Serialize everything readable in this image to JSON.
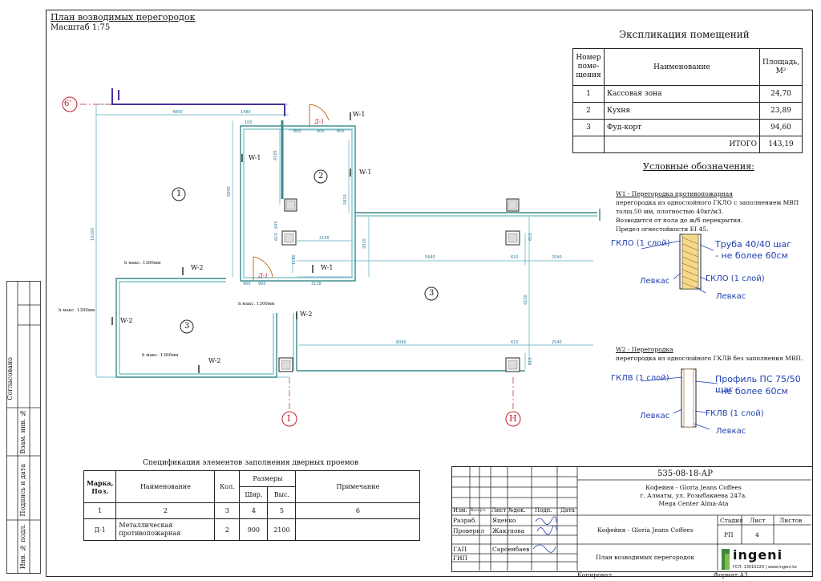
{
  "header": {
    "title": "План возводимых перегородок",
    "scale": "Масштаб 1:75"
  },
  "axes": {
    "a6": "6'",
    "i": "I",
    "n": "Н"
  },
  "rooms": [
    {
      "num": "1"
    },
    {
      "num": "2"
    },
    {
      "num": "3"
    },
    {
      "num": "3"
    }
  ],
  "wall_labels": [
    "W-1",
    "W-1",
    "W-1",
    "W-1",
    "W-2",
    "W-2",
    "W-2",
    "W-2"
  ],
  "door_labels": [
    "Д-1",
    "Д-1"
  ],
  "heights": [
    "h макс. 1300мм",
    "h макс. 1300мм",
    "h макс. 1300мм",
    "h макс. 1300мм"
  ],
  "dims": [
    "4800",
    "1480",
    "100",
    "800",
    "900",
    "800",
    "4105",
    "6000",
    "10200",
    "5810",
    "2145",
    "2020",
    "5845",
    "610",
    "2540",
    "4230",
    "8090",
    "610",
    "2540",
    "610",
    "1180",
    "610",
    "900",
    "3118",
    "960",
    "1075",
    "645",
    "610"
  ],
  "explication": {
    "title": "Экспликация помещений",
    "headers": [
      "Номер поме-щения",
      "Наименование",
      "Площадь, М²"
    ],
    "rows": [
      [
        "1",
        "Кассовая зона",
        "24,70"
      ],
      [
        "2",
        "Кухня",
        "23,89"
      ],
      [
        "3",
        "Фуд-корт",
        "94,60"
      ]
    ],
    "total_label": "ИТОГО",
    "total": "143,19"
  },
  "legend": {
    "title": "Условные обозначения:",
    "w1_title": "W1 - Перегородка противопожарная",
    "w1_lines": [
      "перегородка из однослойного ГКЛО с заполнением МВП",
      "толщ.50 мм, плотностью 40кг/м3.",
      "Возводится от пола до ж/б перекрытия.",
      "Предел огнестойкости EI 45."
    ],
    "w1_labels": {
      "left_top": "ГКЛО (1 слой)",
      "pipe": "Труба 40/40 шаг",
      "pipe2": "- не более 60см",
      "levkas1": "Левкас",
      "right_mid": "ГКЛО (1 слой)",
      "levkas2": "Левкас"
    },
    "w2_title": "W2 - Перегородка",
    "w2_lines": [
      "перегородка из однослойного ГКЛВ без заполнения МВП."
    ],
    "w2_labels": {
      "left_top": "ГКЛВ (1 слой)",
      "profile": "Профиль ПС 75/50 шаг",
      "profile2": "- не более 60см",
      "levkas1": "Левкас",
      "right_mid": "ГКЛВ (1 слой)",
      "levkas2": "Левкас"
    }
  },
  "spec": {
    "title": "Спецификация элементов заполнения дверных проемов",
    "h_mark": "Марка, Поз.",
    "h_name": "Наименование",
    "h_qty": "Кол.",
    "h_sizes": "Размеры",
    "h_w": "Шир.",
    "h_h": "Выс.",
    "h_note": "Примечание",
    "idx": [
      "1",
      "2",
      "3",
      "4",
      "5",
      "6"
    ],
    "row": {
      "mark": "Д-1",
      "name": "Металлическая противопожарная",
      "qty": "2",
      "w": "900",
      "h": "2100",
      "note": ""
    }
  },
  "stamp": {
    "code": "535-08-18-АР",
    "project_lines": [
      "Кофейня - Gloria Jeans Coffees",
      "г. Алматы, ул. Розыбакиева 247а.",
      "Mega Center Alma-Ata"
    ],
    "cols": [
      "Изм.",
      "Кол.уч.",
      "Лист",
      "№док.",
      "Подп.",
      "Дата"
    ],
    "r1": [
      "Разраб.",
      "Яценко"
    ],
    "r2": [
      "Проверил",
      "Жакупова"
    ],
    "r3": [
      "ГАП",
      "Сарсенбаев"
    ],
    "r4": [
      "ГИП",
      ""
    ],
    "object": "Кофейня - Gloria Jeans Coffees",
    "sheet_name": "План возводимых перегородок",
    "stage_h": "Стадия",
    "sheet_h": "Лист",
    "sheets_h": "Листов",
    "stage": "РП",
    "sheet": "4",
    "sheets": "",
    "copied": "Копировал",
    "format": "Формат А3",
    "logo": "ingeni",
    "logo_sub": "ГСЛ: 13010220 | www.ingeni.kz"
  },
  "sidebar": [
    "Согласовано",
    "Взам. инв. №",
    "Подпись и дата",
    "Инв. № подл."
  ],
  "colors": {
    "wall": "#3a8a8a",
    "wall_inner": "#7fc7c7",
    "dim": "#2a7f9a",
    "red": "#c0202a",
    "blue": "#1f3fb0",
    "purple": "#4b2f9a"
  }
}
